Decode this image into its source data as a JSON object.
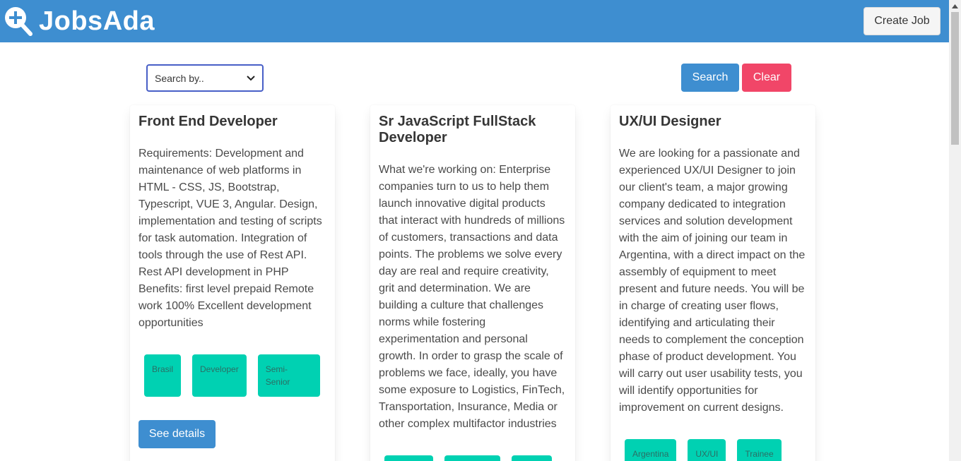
{
  "header": {
    "brand": "JobsAda",
    "brand_icon": "search-plus-icon",
    "create_label": "Create Job",
    "color": "#3e8ed0"
  },
  "search": {
    "select_value": "Search by..",
    "search_label": "Search",
    "clear_label": "Clear"
  },
  "jobs": [
    {
      "title": "Front End Developer",
      "description": "Requirements: Development and maintenance of web platforms in HTML - CSS, JS, Bootstrap, Typescript, VUE 3, Angular. Design, implementation and testing of scripts for task automation. Integration of tools through the use of Rest API. Rest API development in PHP Benefits: first level prepaid Remote work 100% Excellent development opportunities",
      "tags": [
        "Brasil",
        "Developer",
        "Semi-Senior"
      ],
      "details_label": "See details"
    },
    {
      "title": "Sr JavaScript FullStack Developer",
      "description": "What we're working on: Enterprise companies turn to us to help them launch innovative digital products that interact with hundreds of millions of customers, transactions and data points. The problems we solve every day are real and require creativity, grit and determination. We are building a culture that challenges norms while fostering experimentation and personal growth. In order to grasp the scale of problems we face, ideally, you have some exposure to Logistics, FinTech, Transportation, Insurance, Media or other complex multifactor industries",
      "tags": [
        "",
        "",
        ""
      ]
    },
    {
      "title": "UX/UI Designer",
      "description": "We are looking for a passionate and experienced UX/UI Designer to join our client's team, a major growing company dedicated to integration services and solution development with the aim of joining our team in Argentina, with a direct impact on the assembly of equipment to meet present and future needs. You will be in charge of creating user flows, identifying and articulating their needs to complement the conception phase of product development. You will carry out user usability tests, you will identify opportunities for improvement on current designs.",
      "tags": [
        "Argentina",
        "UX/UI",
        "Trainee"
      ]
    }
  ],
  "colors": {
    "primary": "#3e8ed0",
    "danger": "#f14668",
    "tag": "#00d1b2"
  }
}
